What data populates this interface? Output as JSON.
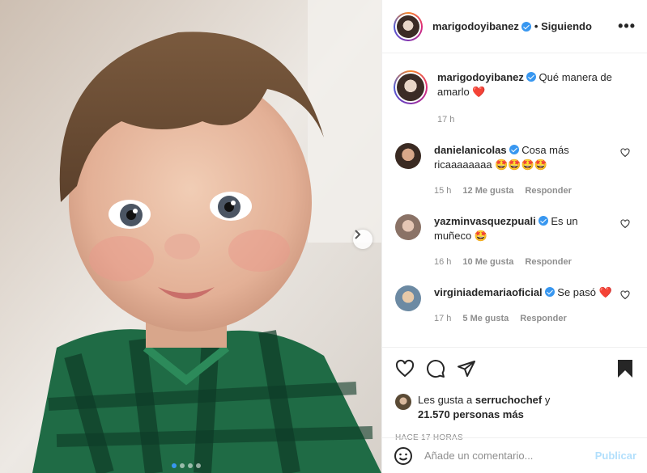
{
  "post": {
    "author": "marigodoyibanez",
    "follow_status": "• Siguiendo",
    "more_label": "•••",
    "caption_text": "Qué manera de amarlo",
    "caption_emoji": "❤️",
    "caption_time": "17 h"
  },
  "comments": [
    {
      "user": "danielanicolas",
      "text": "Cosa más ricaaaaaaaa 🤩🤩🤩🤩",
      "time": "15 h",
      "likes": "12 Me gusta",
      "reply": "Responder"
    },
    {
      "user": "yazminvasquezpuali",
      "text": "Es un muñeco 🤩",
      "time": "16 h",
      "likes": "10 Me gusta",
      "reply": "Responder"
    },
    {
      "user": "virginiademariaoficial",
      "text": "Se pasó ❤️",
      "time": "17 h",
      "likes": "5 Me gusta",
      "reply": "Responder"
    }
  ],
  "likes": {
    "prefix": "Les gusta a",
    "user": "serruchochef",
    "connector": "y",
    "others": "21.570 personas más"
  },
  "posted": "HACE 17 HORAS",
  "add_comment": {
    "placeholder": "Añade un comentario...",
    "publish_label": "Publicar"
  },
  "carousel": {
    "total": 4,
    "current": 1
  },
  "colors": {
    "verified": "#3897f0",
    "heart": "#ed4956",
    "publish_disabled": "#b2dffc"
  }
}
